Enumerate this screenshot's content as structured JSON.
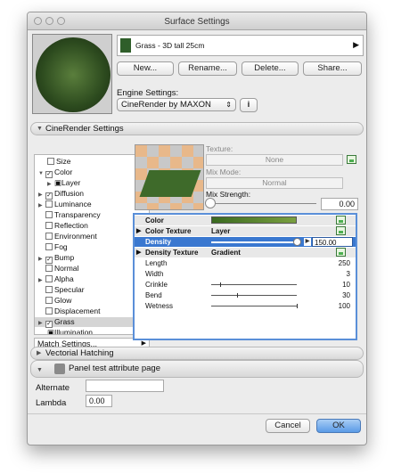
{
  "window": {
    "title": "Surface Settings"
  },
  "surface": {
    "name": "Grass - 3D tall 25cm",
    "swatch_color": "#2f5e2a"
  },
  "buttons": {
    "new": "New...",
    "rename": "Rename...",
    "delete": "Delete...",
    "share": "Share...",
    "cancel": "Cancel",
    "ok": "OK"
  },
  "engine": {
    "label": "Engine Settings:",
    "value": "CineRender by MAXON"
  },
  "sections": {
    "cinerender": "CineRender Settings",
    "hatching": "Vectorial Hatching",
    "panel": "Panel test attribute page"
  },
  "tree": [
    {
      "label": "Size",
      "checked": false
    },
    {
      "label": "Color",
      "checked": true
    },
    {
      "label": "Layer",
      "checked": false
    },
    {
      "label": "Diffusion",
      "checked": true
    },
    {
      "label": "Luminance",
      "checked": false
    },
    {
      "label": "Transparency",
      "checked": false
    },
    {
      "label": "Reflection",
      "checked": false
    },
    {
      "label": "Environment",
      "checked": false
    },
    {
      "label": "Fog",
      "checked": false
    },
    {
      "label": "Bump",
      "checked": true
    },
    {
      "label": "Normal",
      "checked": false
    },
    {
      "label": "Alpha",
      "checked": false
    },
    {
      "label": "Specular",
      "checked": false
    },
    {
      "label": "Glow",
      "checked": false
    },
    {
      "label": "Displacement",
      "checked": false
    },
    {
      "label": "Grass",
      "checked": true
    },
    {
      "label": "Illumination",
      "checked": false
    }
  ],
  "match_settings": "Match Settings...",
  "texture": {
    "label": "Texture:",
    "value": "None",
    "mix_mode_label": "Mix Mode:",
    "mix_mode": "Normal",
    "mix_strength_label": "Mix Strength:",
    "mix_strength": "0.00"
  },
  "params": {
    "color": {
      "label": "Color",
      "value": "#4a7a2a"
    },
    "color_texture": {
      "label": "Color Texture",
      "value": "Layer"
    },
    "density": {
      "label": "Density",
      "value": "150.00"
    },
    "density_texture": {
      "label": "Density Texture",
      "value": "Gradient"
    },
    "sliders": [
      {
        "label": "Length",
        "value": "250",
        "fraction": 1.0
      },
      {
        "label": "Width",
        "value": "3",
        "fraction": 1.0
      },
      {
        "label": "Crinkle",
        "value": "10",
        "fraction": 0.1
      },
      {
        "label": "Bend",
        "value": "30",
        "fraction": 0.3
      },
      {
        "label": "Wetness",
        "value": "100",
        "fraction": 1.0
      }
    ]
  },
  "bottom": {
    "alternate_label": "Alternate",
    "alternate_value": "",
    "lambda_label": "Lambda",
    "lambda_value": "0.00"
  }
}
